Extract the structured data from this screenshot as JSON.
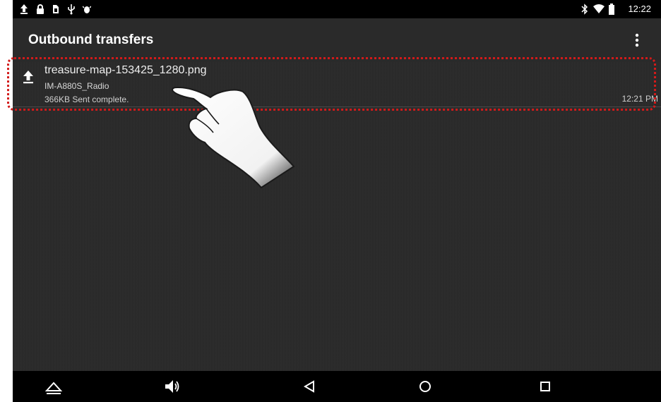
{
  "status_bar": {
    "icons": [
      "upload-icon",
      "lock-icon",
      "sim-card-icon",
      "usb-icon",
      "android-debug-icon",
      "bluetooth-icon",
      "wifi-icon",
      "battery-icon"
    ],
    "time": "12:22"
  },
  "app_bar": {
    "title": "Outbound transfers",
    "menu_icon": "more-vert-icon"
  },
  "transfers": [
    {
      "icon": "upload-icon",
      "file_name": "treasure-map-153425_1280.png",
      "device_name": "IM-A880S_Radio",
      "status": "366KB Sent complete.",
      "time": "12:21 PM"
    }
  ],
  "nav_bar": {
    "icons": [
      "collapse-icon",
      "volume-icon",
      "back-icon",
      "home-icon",
      "recents-icon"
    ]
  },
  "colors": {
    "highlight": "#d21a1a",
    "background": "#212121",
    "app_bar": "#2a2a2a"
  }
}
